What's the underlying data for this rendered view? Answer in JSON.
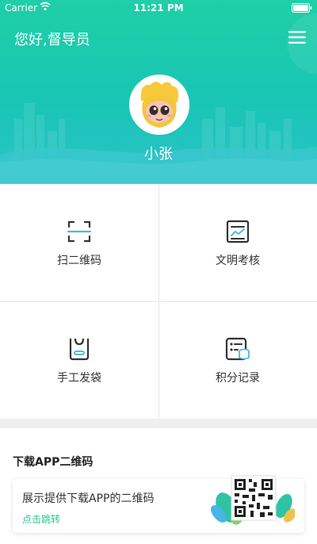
{
  "statusbar": {
    "carrier": "Carrier",
    "time": "11:21 PM"
  },
  "header": {
    "greeting": "您好,督导员",
    "username": "小张"
  },
  "grid": [
    {
      "label": "扫二维码",
      "icon": "scan-icon"
    },
    {
      "label": "文明考核",
      "icon": "chart-board-icon"
    },
    {
      "label": "手工发袋",
      "icon": "bag-icon"
    },
    {
      "label": "积分记录",
      "icon": "points-record-icon"
    }
  ],
  "download": {
    "title": "下载APP二维码",
    "desc": "展示提供下载APP的二维码",
    "link": "点击跳转"
  },
  "colors": {
    "header_top": "#1fcfa7",
    "header_bottom": "#2bc3c8",
    "accent_green": "#25c68e",
    "icon_blue": "#4fb8e8"
  }
}
